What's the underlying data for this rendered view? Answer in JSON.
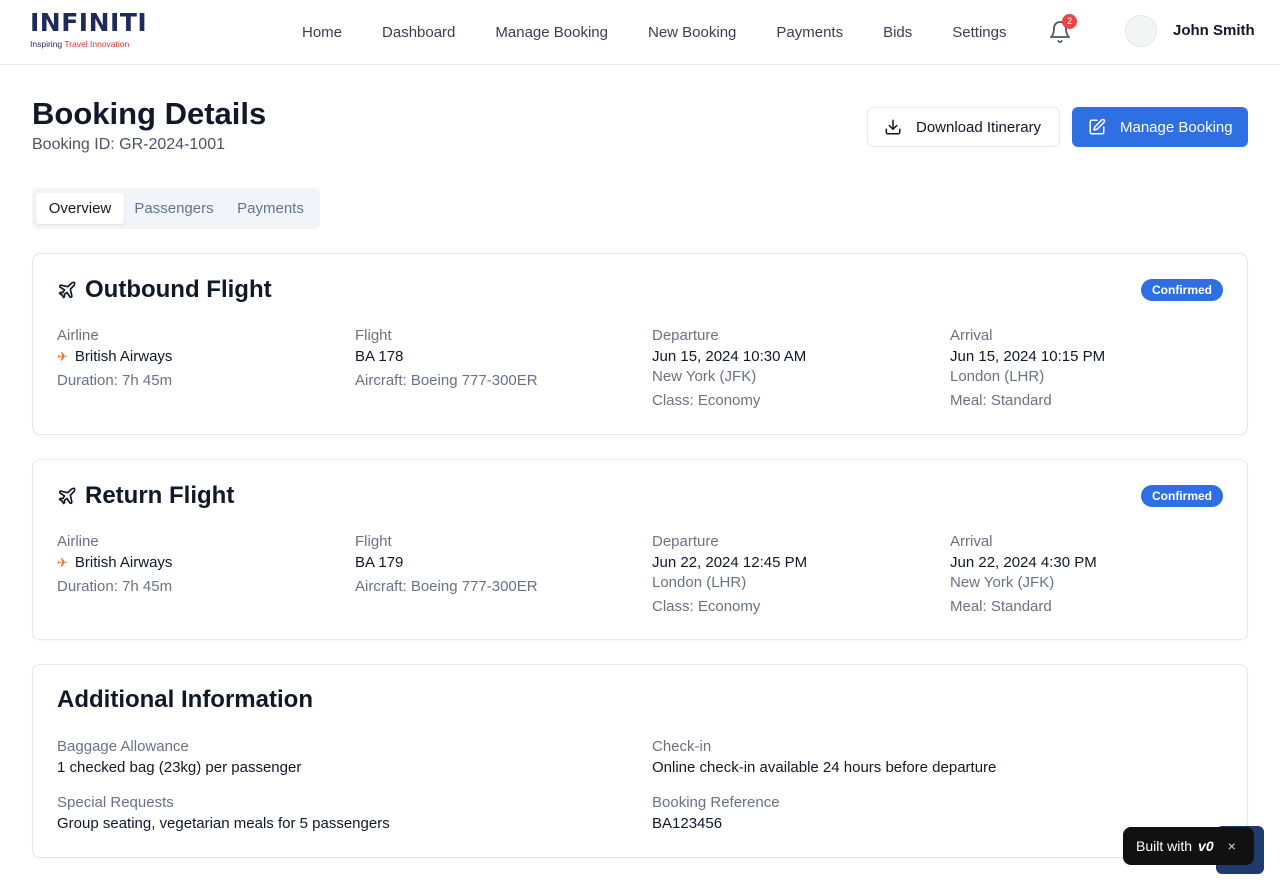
{
  "header": {
    "logo_word": "INFINITI",
    "logo_tag_a": "Inspiring ",
    "logo_tag_b": "Travel Innovation",
    "nav": [
      "Home",
      "Dashboard",
      "Manage Booking",
      "New Booking",
      "Payments",
      "Bids",
      "Settings"
    ],
    "notification_count": "2",
    "user_name": "John Smith",
    "icons": {
      "bell": "bell-icon",
      "avatar": "avatar"
    }
  },
  "page": {
    "title": "Booking Details",
    "booking_id": "Booking ID: GR-2024-1001",
    "download_label": "Download Itinerary",
    "manage_label": "Manage Booking"
  },
  "tabs": [
    {
      "label": "Overview",
      "active": true
    },
    {
      "label": "Passengers",
      "active": false
    },
    {
      "label": "Payments",
      "active": false
    }
  ],
  "flights": [
    {
      "title": "Outbound Flight",
      "status": "Confirmed",
      "airline_label": "Airline",
      "airline": "British Airways",
      "duration": "Duration: 7h 45m",
      "flight_label": "Flight",
      "flight_no": "BA 178",
      "aircraft": "Aircraft: Boeing 777-300ER",
      "departure_label": "Departure",
      "departure_time": "Jun 15, 2024 10:30 AM",
      "departure_place": "New York (JFK)",
      "class": "Class: Economy",
      "arrival_label": "Arrival",
      "arrival_time": "Jun 15, 2024 10:15 PM",
      "arrival_place": "London (LHR)",
      "meal": "Meal: Standard"
    },
    {
      "title": "Return Flight",
      "status": "Confirmed",
      "airline_label": "Airline",
      "airline": "British Airways",
      "duration": "Duration: 7h 45m",
      "flight_label": "Flight",
      "flight_no": "BA 179",
      "aircraft": "Aircraft: Boeing 777-300ER",
      "departure_label": "Departure",
      "departure_time": "Jun 22, 2024 12:45 PM",
      "departure_place": "London (LHR)",
      "class": "Class: Economy",
      "arrival_label": "Arrival",
      "arrival_time": "Jun 22, 2024 4:30 PM",
      "arrival_place": "New York (JFK)",
      "meal": "Meal: Standard"
    }
  ],
  "additional": {
    "title": "Additional Information",
    "baggage_label": "Baggage Allowance",
    "baggage": "1 checked bag (23kg) per passenger",
    "checkin_label": "Check-in",
    "checkin": "Online check-in available 24 hours before departure",
    "special_label": "Special Requests",
    "special": "Group seating, vegetarian meals for 5 passengers",
    "ref_label": "Booking Reference",
    "ref": "BA123456"
  },
  "widget": {
    "text": "Built with",
    "brand": "v0",
    "close": "×"
  },
  "colors": {
    "primary": "#2f6fe4",
    "badge": "#2f6fe4",
    "notification": "#ef4444",
    "airline_icon": "#f97316",
    "logo": "#1e2a5a",
    "logo_accent": "#d9342b"
  }
}
